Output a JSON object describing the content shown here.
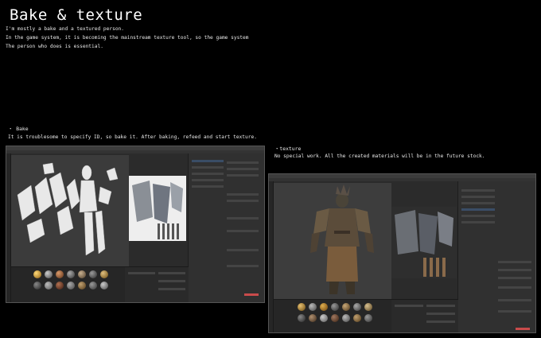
{
  "header": {
    "title": "Bake & texture",
    "intro_lines": [
      "I'm mostly a bake and a textured person.",
      "In the game system, it is becoming the mainstream texture tool, so the game system",
      "The person who does is essential."
    ]
  },
  "sections": {
    "bake": {
      "label": "・ Bake",
      "description": "It is troublesome to specify ID, so bake it. After baking, refeed and start texture."
    },
    "texture": {
      "label": "・texture",
      "description": "No special work. All the created materials will be in the future stock."
    }
  },
  "colors": {
    "background": "#000000",
    "app_panel": "#2b2b2b",
    "viewport": "#3a3a3a",
    "selection": "#3a4d66",
    "accent_red": "#c94b4b"
  }
}
